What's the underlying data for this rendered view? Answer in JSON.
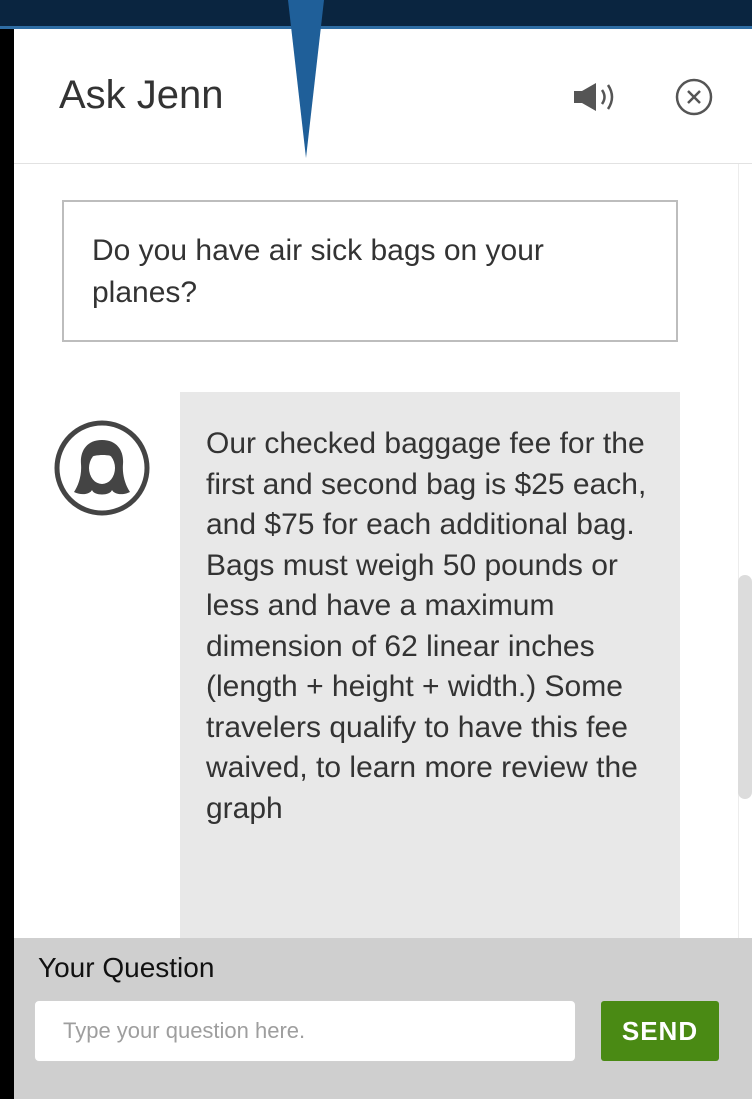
{
  "header": {
    "title": "Ask Jenn",
    "speaker_icon": "speaker-volume-icon",
    "close_icon": "close-circle-icon"
  },
  "conversation": {
    "user_question": "Do you have air sick bags on your planes?",
    "assistant_avatar_icon": "woman-avatar-icon",
    "assistant_answer": "Our checked baggage fee for the first and second bag is $25 each, and $75 for each additional bag. Bags must weigh 50 pounds or less and have a maximum dimension of 62 linear inches (length + height + width.) Some travelers qualify to have this fee waived, to learn more review the graph"
  },
  "input": {
    "label": "Your Question",
    "placeholder": "Type your question here.",
    "value": "",
    "send_label": "SEND"
  },
  "colors": {
    "top_band": "#0a2540",
    "accent_line": "#2e6da4",
    "send_button": "#4a8a14",
    "footer_bg": "#cfcfcf",
    "answer_bg": "#e8e8e8",
    "pointer": "#1f5f99"
  }
}
